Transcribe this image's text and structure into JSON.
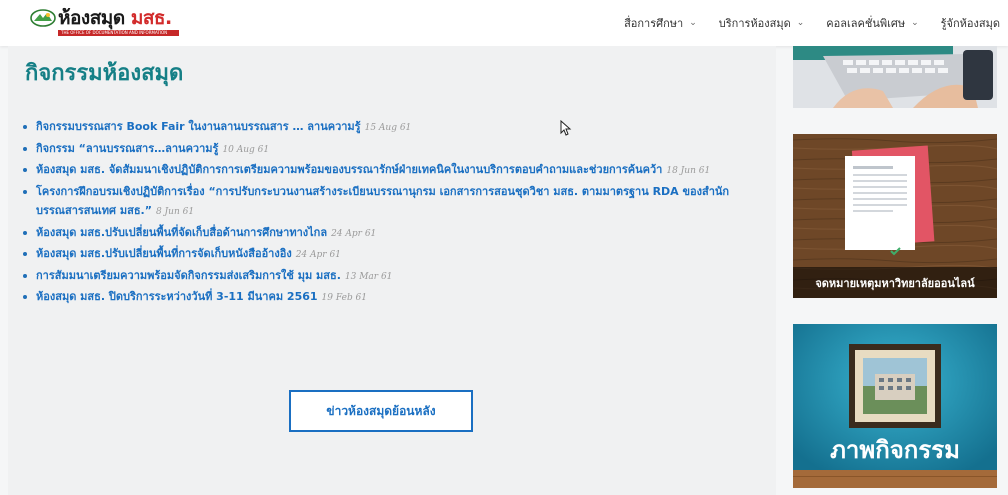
{
  "header": {
    "logo_text": "ห้องสมุด",
    "logo_brand": "มสธ.",
    "logo_tagline": "THE OFFICE OF DOCUMENTATION AND INFORMATION",
    "nav": [
      {
        "label": "สื่อการศึกษา",
        "has_dropdown": true
      },
      {
        "label": "บริการห้องสมุด",
        "has_dropdown": true
      },
      {
        "label": "คอลเลคชั่นพิเศษ",
        "has_dropdown": true
      },
      {
        "label": "รู้จักห้องสมุด",
        "has_dropdown": false
      }
    ]
  },
  "main": {
    "title": "กิจกรรมห้องสมุด",
    "news": [
      {
        "text": "กิจกรรมบรรณสาร Book Fair ในงานลานบรรณสาร … ลานความรู้",
        "date": "15 Aug 61"
      },
      {
        "text": "กิจกรรม “ลานบรรณสาร…ลานความรู้",
        "date": "10 Aug 61"
      },
      {
        "text": "ห้องสมุด มสธ. จัดสัมมนาเชิงปฏิบัติการการเตรียมความพร้อมของบรรณารักษ์ฝ่ายเทคนิคในงานบริการตอบคำถามและช่วยการค้นคว้า",
        "date": "18 Jun 61"
      },
      {
        "text": "โครงการฝึกอบรมเชิงปฏิบัติการเรื่อง “การปรับกระบวนงานสร้างระเบียนบรรณานุกรม เอกสารการสอนชุดวิชา มสธ. ตามมาตรฐาน RDA ของสำนักบรรณสารสนเทศ มสธ.”",
        "date": "8 Jun 61"
      },
      {
        "text": "ห้องสมุด มสธ.ปรับเปลี่ยนพื้นที่จัดเก็บสื่อด้านการศึกษาทางไกล",
        "date": "24 Apr 61"
      },
      {
        "text": "ห้องสมุด มสธ.ปรับเปลี่ยนพื้นที่การจัดเก็บหนังสืออ้างอิง",
        "date": "24 Apr 61"
      },
      {
        "text": "การสัมมนาเตรียมความพร้อมจัดกิจกรรมส่งเสริมการใช้ มุม มสธ.",
        "date": "13 Mar 61"
      },
      {
        "text": "ห้องสมุด มสธ. ปิดบริการระหว่างวันที่ 3-11 มีนาคม 2561",
        "date": "19 Feb 61"
      }
    ],
    "archive_button": "ข่าวห้องสมุดย้อนหลัง"
  },
  "sidebar": {
    "banner2_caption": "จดหมายเหตุมหาวิทยาลัยออนไลน์",
    "banner3_caption": "ภาพกิจกรรม"
  },
  "colors": {
    "title": "#157f86",
    "link": "#1a6fc2",
    "brand_red": "#c62828"
  }
}
